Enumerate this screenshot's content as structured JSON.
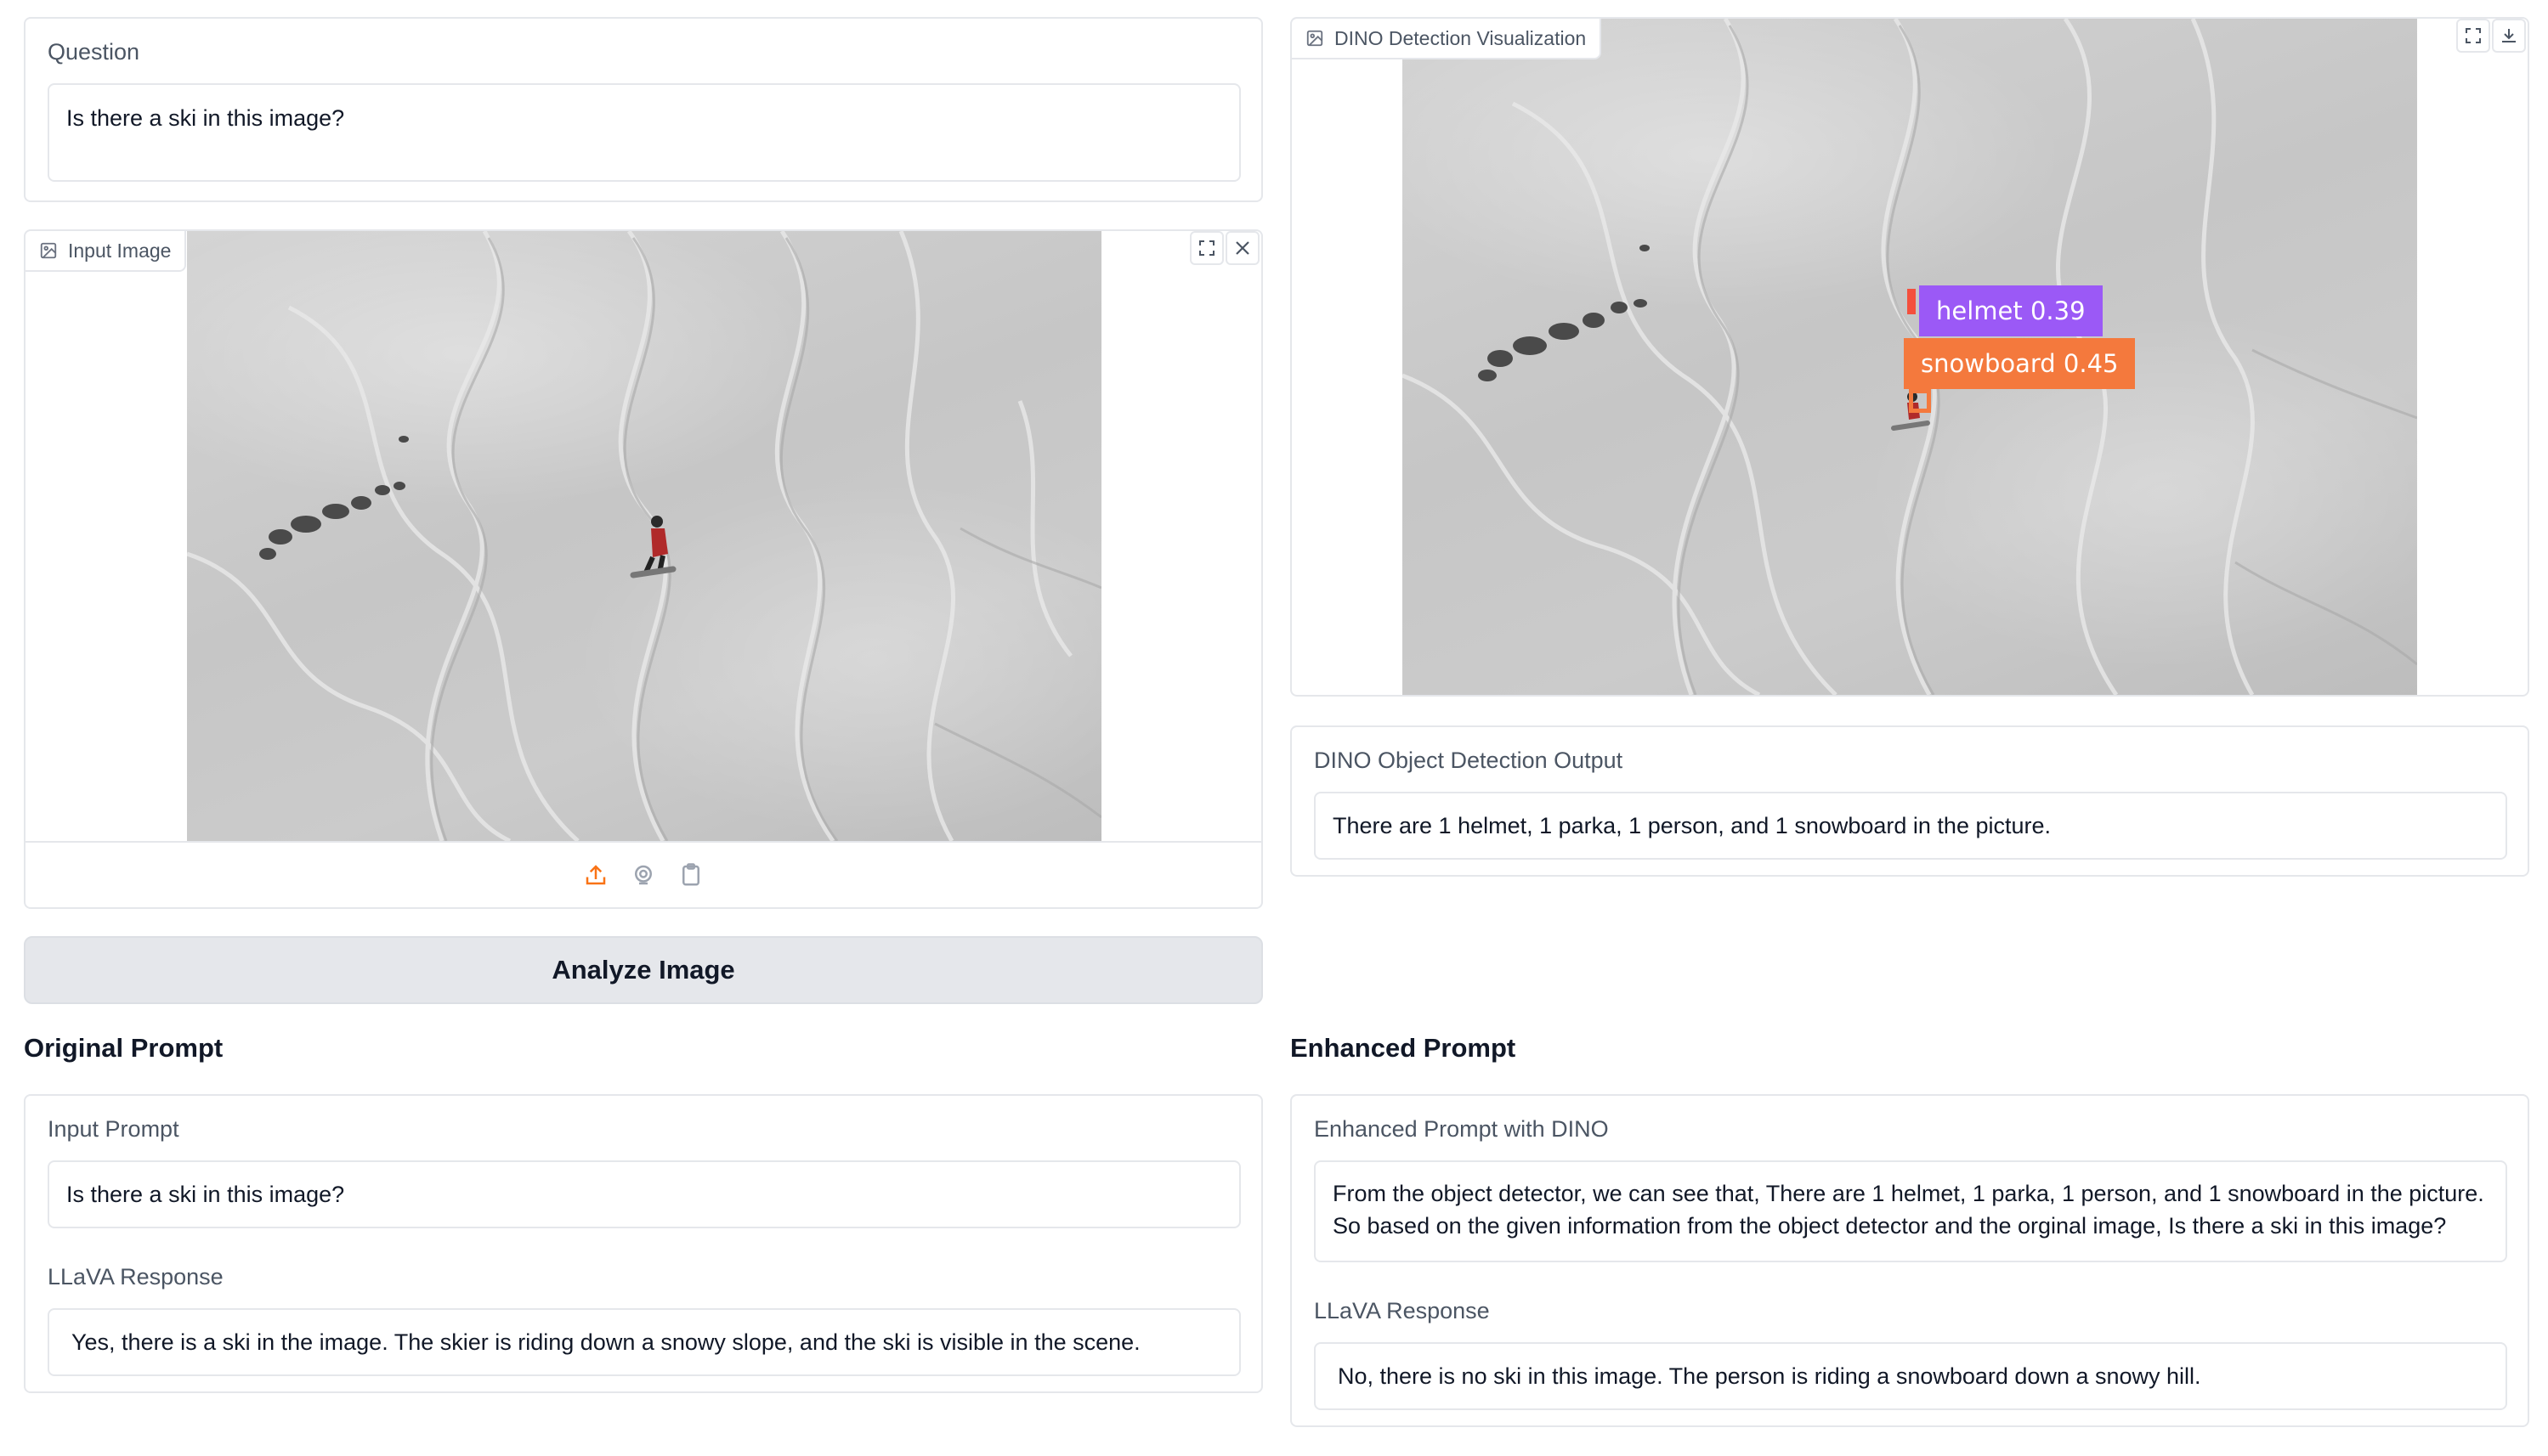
{
  "question": {
    "label": "Question",
    "value": "Is there a ski in this image?"
  },
  "input_image": {
    "label": "Input Image",
    "icons": [
      "fullscreen-icon",
      "close-icon",
      "upload-icon",
      "webcam-icon",
      "clipboard-icon"
    ]
  },
  "analyze_button": {
    "label": "Analyze Image"
  },
  "detection_visualization": {
    "label": "DINO Detection Visualization",
    "icons": [
      "fullscreen-icon",
      "download-icon"
    ],
    "detections": [
      {
        "label": "helmet 0.39",
        "color": "#9b59f6"
      },
      {
        "label": "snowboard 0.45",
        "color": "#f4793d"
      }
    ]
  },
  "detection_output": {
    "label": "DINO Object Detection Output",
    "value": "There are 1 helmet, 1 parka, 1 person, and 1 snowboard in the picture."
  },
  "original_prompt": {
    "heading": "Original Prompt",
    "input_label": "Input Prompt",
    "input_value": "Is there a ski in this image?",
    "response_label": "LLaVA Response",
    "response_value": "Yes, there is a ski in the image. The skier is riding down a snowy slope, and the ski is visible in the scene."
  },
  "enhanced_prompt": {
    "heading": "Enhanced Prompt",
    "input_label": "Enhanced Prompt with DINO",
    "input_value": "From the object detector, we can see that, There are 1 helmet, 1 parka, 1 person, and 1 snowboard in the picture. So based on the given information from the object detector and the orginal image, Is there a ski in this image?",
    "response_label": "LLaVA Response",
    "response_value": "No, there is no ski in this image. The person is riding a snowboard down a snowy hill."
  },
  "colors": {
    "accent": "#f97316",
    "border": "#e5e7eb",
    "button_bg": "#e5e7eb"
  }
}
